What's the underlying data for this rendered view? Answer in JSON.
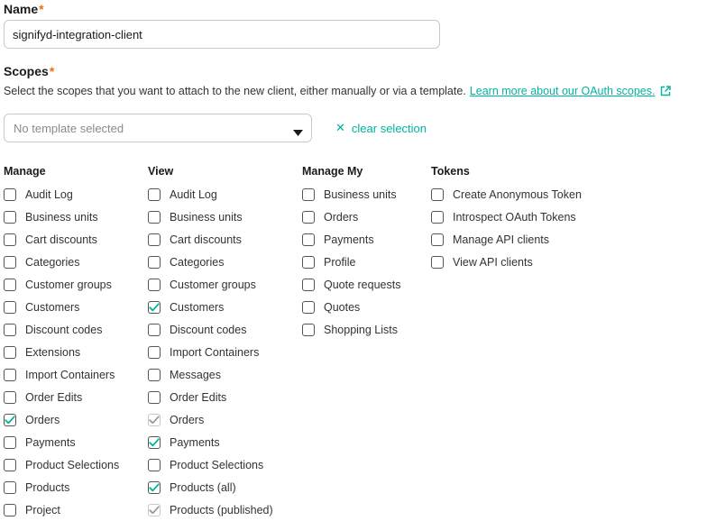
{
  "name_field": {
    "label": "Name",
    "required_mark": "*",
    "value": "signifyd-integration-client"
  },
  "scopes": {
    "label": "Scopes",
    "required_mark": "*",
    "help_text": "Select the scopes that you want to attach to the new client, either manually or via a template.",
    "help_link": "Learn more about our OAuth scopes.",
    "template_placeholder": "No template selected",
    "clear_label": "clear selection"
  },
  "colors": {
    "accent": "#00b39e",
    "required": "#f16d0e",
    "disabled_check": "#9a9a9a"
  },
  "columns": [
    {
      "title": "Manage",
      "items": [
        {
          "label": "Audit Log",
          "state": "unchecked"
        },
        {
          "label": "Business units",
          "state": "unchecked"
        },
        {
          "label": "Cart discounts",
          "state": "unchecked"
        },
        {
          "label": "Categories",
          "state": "unchecked"
        },
        {
          "label": "Customer groups",
          "state": "unchecked"
        },
        {
          "label": "Customers",
          "state": "unchecked"
        },
        {
          "label": "Discount codes",
          "state": "unchecked"
        },
        {
          "label": "Extensions",
          "state": "unchecked"
        },
        {
          "label": "Import Containers",
          "state": "unchecked"
        },
        {
          "label": "Order Edits",
          "state": "unchecked"
        },
        {
          "label": "Orders",
          "state": "checked"
        },
        {
          "label": "Payments",
          "state": "unchecked"
        },
        {
          "label": "Product Selections",
          "state": "unchecked"
        },
        {
          "label": "Products",
          "state": "unchecked"
        },
        {
          "label": "Project",
          "state": "unchecked"
        }
      ]
    },
    {
      "title": "View",
      "items": [
        {
          "label": "Audit Log",
          "state": "unchecked"
        },
        {
          "label": "Business units",
          "state": "unchecked"
        },
        {
          "label": "Cart discounts",
          "state": "unchecked"
        },
        {
          "label": "Categories",
          "state": "unchecked"
        },
        {
          "label": "Customer groups",
          "state": "unchecked"
        },
        {
          "label": "Customers",
          "state": "checked"
        },
        {
          "label": "Discount codes",
          "state": "unchecked"
        },
        {
          "label": "Import Containers",
          "state": "unchecked"
        },
        {
          "label": "Messages",
          "state": "unchecked"
        },
        {
          "label": "Order Edits",
          "state": "unchecked"
        },
        {
          "label": "Orders",
          "state": "disabled-checked"
        },
        {
          "label": "Payments",
          "state": "checked"
        },
        {
          "label": "Product Selections",
          "state": "unchecked"
        },
        {
          "label": "Products (all)",
          "state": "checked"
        },
        {
          "label": "Products (published)",
          "state": "disabled-checked"
        }
      ]
    },
    {
      "title": "Manage My",
      "items": [
        {
          "label": "Business units",
          "state": "unchecked"
        },
        {
          "label": "Orders",
          "state": "unchecked"
        },
        {
          "label": "Payments",
          "state": "unchecked"
        },
        {
          "label": "Profile",
          "state": "unchecked"
        },
        {
          "label": "Quote requests",
          "state": "unchecked"
        },
        {
          "label": "Quotes",
          "state": "unchecked"
        },
        {
          "label": "Shopping Lists",
          "state": "unchecked"
        }
      ]
    },
    {
      "title": "Tokens",
      "items": [
        {
          "label": "Create Anonymous Token",
          "state": "unchecked"
        },
        {
          "label": "Introspect OAuth Tokens",
          "state": "unchecked"
        },
        {
          "label": "Manage API clients",
          "state": "unchecked"
        },
        {
          "label": "View API clients",
          "state": "unchecked"
        }
      ]
    }
  ]
}
